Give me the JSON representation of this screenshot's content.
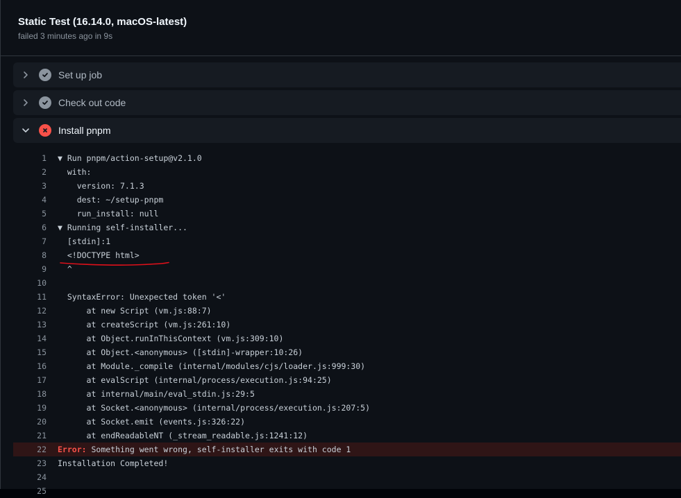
{
  "job": {
    "title": "Static Test (16.14.0, macOS-latest)",
    "subtitle": "failed 3 minutes ago in 9s"
  },
  "steps": [
    {
      "label": "Set up job",
      "status": "success",
      "expanded": false
    },
    {
      "label": "Check out code",
      "status": "success",
      "expanded": false
    },
    {
      "label": "Install pnpm",
      "status": "failure",
      "expanded": true
    }
  ],
  "log": [
    {
      "n": "1",
      "text": "▼ Run pnpm/action-setup@v2.1.0"
    },
    {
      "n": "2",
      "text": "  with:"
    },
    {
      "n": "3",
      "text": "    version: 7.1.3"
    },
    {
      "n": "4",
      "text": "    dest: ~/setup-pnpm"
    },
    {
      "n": "5",
      "text": "    run_install: null"
    },
    {
      "n": "6",
      "text": "▼ Running self-installer..."
    },
    {
      "n": "7",
      "text": "  [stdin]:1"
    },
    {
      "n": "8",
      "text": "  <!DOCTYPE html>"
    },
    {
      "n": "9",
      "text": "  ^"
    },
    {
      "n": "10",
      "text": ""
    },
    {
      "n": "11",
      "text": "  SyntaxError: Unexpected token '<'"
    },
    {
      "n": "12",
      "text": "      at new Script (vm.js:88:7)"
    },
    {
      "n": "13",
      "text": "      at createScript (vm.js:261:10)"
    },
    {
      "n": "14",
      "text": "      at Object.runInThisContext (vm.js:309:10)"
    },
    {
      "n": "15",
      "text": "      at Object.<anonymous> ([stdin]-wrapper:10:26)"
    },
    {
      "n": "16",
      "text": "      at Module._compile (internal/modules/cjs/loader.js:999:30)"
    },
    {
      "n": "17",
      "text": "      at evalScript (internal/process/execution.js:94:25)"
    },
    {
      "n": "18",
      "text": "      at internal/main/eval_stdin.js:29:5"
    },
    {
      "n": "19",
      "text": "      at Socket.<anonymous> (internal/process/execution.js:207:5)"
    },
    {
      "n": "20",
      "text": "      at Socket.emit (events.js:326:22)"
    },
    {
      "n": "21",
      "text": "      at endReadableNT (_stream_readable.js:1241:12)"
    },
    {
      "n": "22",
      "error_label": "Error:",
      "text": " Something went wrong, self-installer exits with code 1",
      "error": true
    },
    {
      "n": "23",
      "text": "Installation Completed!"
    },
    {
      "n": "24",
      "text": ""
    },
    {
      "n": "25",
      "text": ""
    }
  ],
  "colors": {
    "background": "#0d1117",
    "step_background": "#161b22",
    "success": "#8b949e",
    "failure": "#f85149",
    "annotation": "#e0101a"
  }
}
